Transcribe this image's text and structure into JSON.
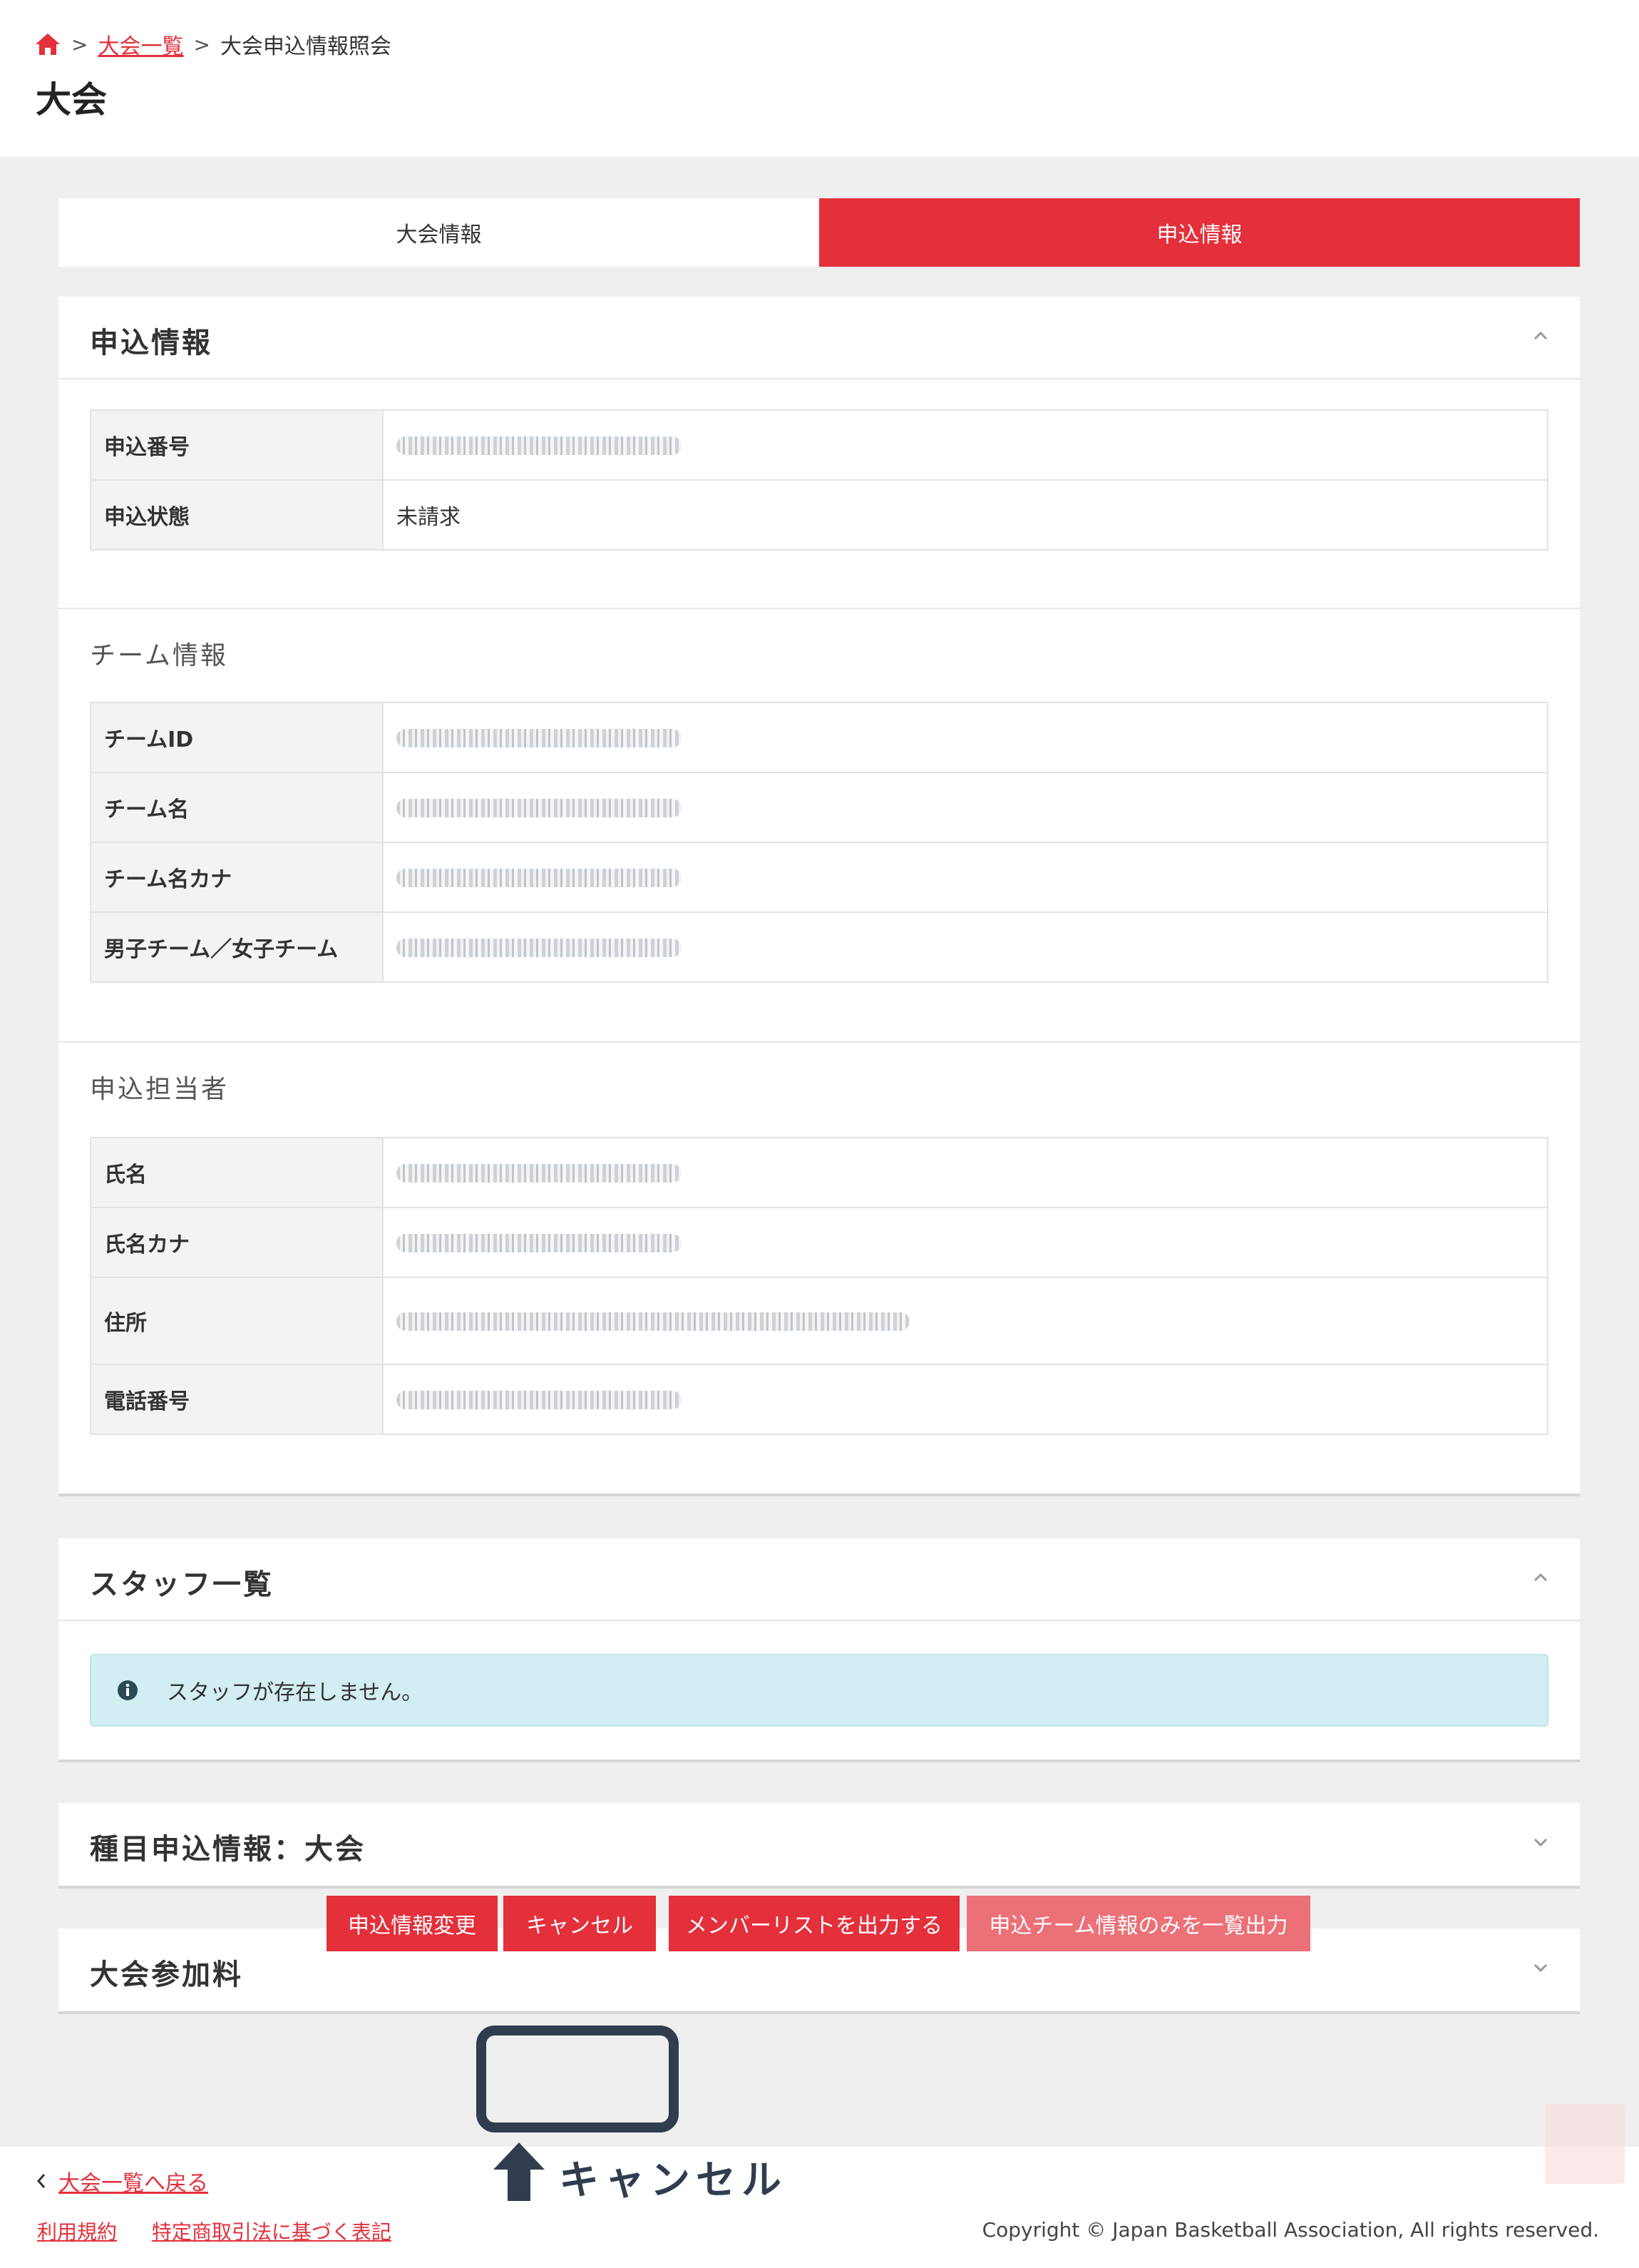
{
  "breadcrumb": {
    "home_icon": "home-icon",
    "link": "大会一覧",
    "current": "大会申込情報照会"
  },
  "page_title": "大会",
  "tabs": [
    {
      "label": "大会情報",
      "active": false
    },
    {
      "label": "申込情報",
      "active": true
    }
  ],
  "application": {
    "title": "申込情報",
    "rows": [
      {
        "label": "申込番号",
        "value": ""
      },
      {
        "label": "申込状態",
        "value": "未請求"
      }
    ],
    "team": {
      "title": "チーム情報",
      "rows": [
        {
          "label": "チームID"
        },
        {
          "label": "チーム名"
        },
        {
          "label": "チーム名カナ"
        },
        {
          "label": "男子チーム／女子チーム"
        }
      ]
    },
    "person": {
      "title": "申込担当者",
      "rows": [
        {
          "label": "氏名"
        },
        {
          "label": "氏名カナ"
        },
        {
          "label": "住所"
        },
        {
          "label": "電話番号"
        }
      ]
    }
  },
  "staff": {
    "title": "スタッフ一覧",
    "message": "スタッフが存在しません。"
  },
  "events": {
    "title": "種目申込情報：大会"
  },
  "fee": {
    "title": "大会参加料"
  },
  "buttons": {
    "change": "申込情報変更",
    "cancel": "キャンセル",
    "member_list": "メンバーリストを出力する",
    "team_export": "申込チーム情報のみを一覧出力"
  },
  "annotation": {
    "label": "キャンセル"
  },
  "footer": {
    "back": "大会一覧へ戻る",
    "terms": "利用規約",
    "commerce": "特定商取引法に基づく表記",
    "copyright": "Copyright © Japan Basketball Association, All rights reserved."
  },
  "colors": {
    "accent": "#e3303b",
    "accent_light": "#ec7077",
    "annotation": "#2f3d4f",
    "alert_bg": "#d3eef2"
  }
}
